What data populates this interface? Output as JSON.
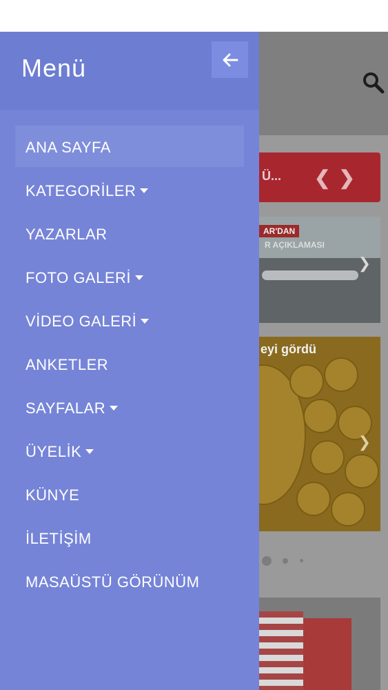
{
  "drawer": {
    "title": "Menü",
    "items": [
      {
        "label": "ANA SAYFA",
        "has_dropdown": false,
        "active": true
      },
      {
        "label": "KATEGORİLER",
        "has_dropdown": true
      },
      {
        "label": "YAZARLAR",
        "has_dropdown": false
      },
      {
        "label": "FOTO GALERİ",
        "has_dropdown": true
      },
      {
        "label": "VİDEO GALERİ",
        "has_dropdown": true
      },
      {
        "label": "ANKETLER",
        "has_dropdown": false
      },
      {
        "label": "SAYFALAR",
        "has_dropdown": true
      },
      {
        "label": "ÜYELİK",
        "has_dropdown": true
      },
      {
        "label": "KÜNYE",
        "has_dropdown": false
      },
      {
        "label": "İLETİŞİM",
        "has_dropdown": false
      },
      {
        "label": "MASAÜSTÜ GÖRÜNÜM",
        "has_dropdown": false
      }
    ]
  },
  "background": {
    "ticker_text": "Ü...",
    "card1_label": "AR'DAN",
    "card1_sublabel": "R AÇIKLAMASI",
    "card2_headline": "eyi gördü"
  },
  "icons": {
    "back": "arrow-left-icon",
    "search": "search-icon",
    "caret": "caret-down-icon"
  },
  "colors": {
    "drawer_bg": "#7584d7",
    "drawer_header_bg": "#6d7dd2",
    "active_item_bg": "#7f8edb",
    "ticker_bg": "#a8272f"
  }
}
